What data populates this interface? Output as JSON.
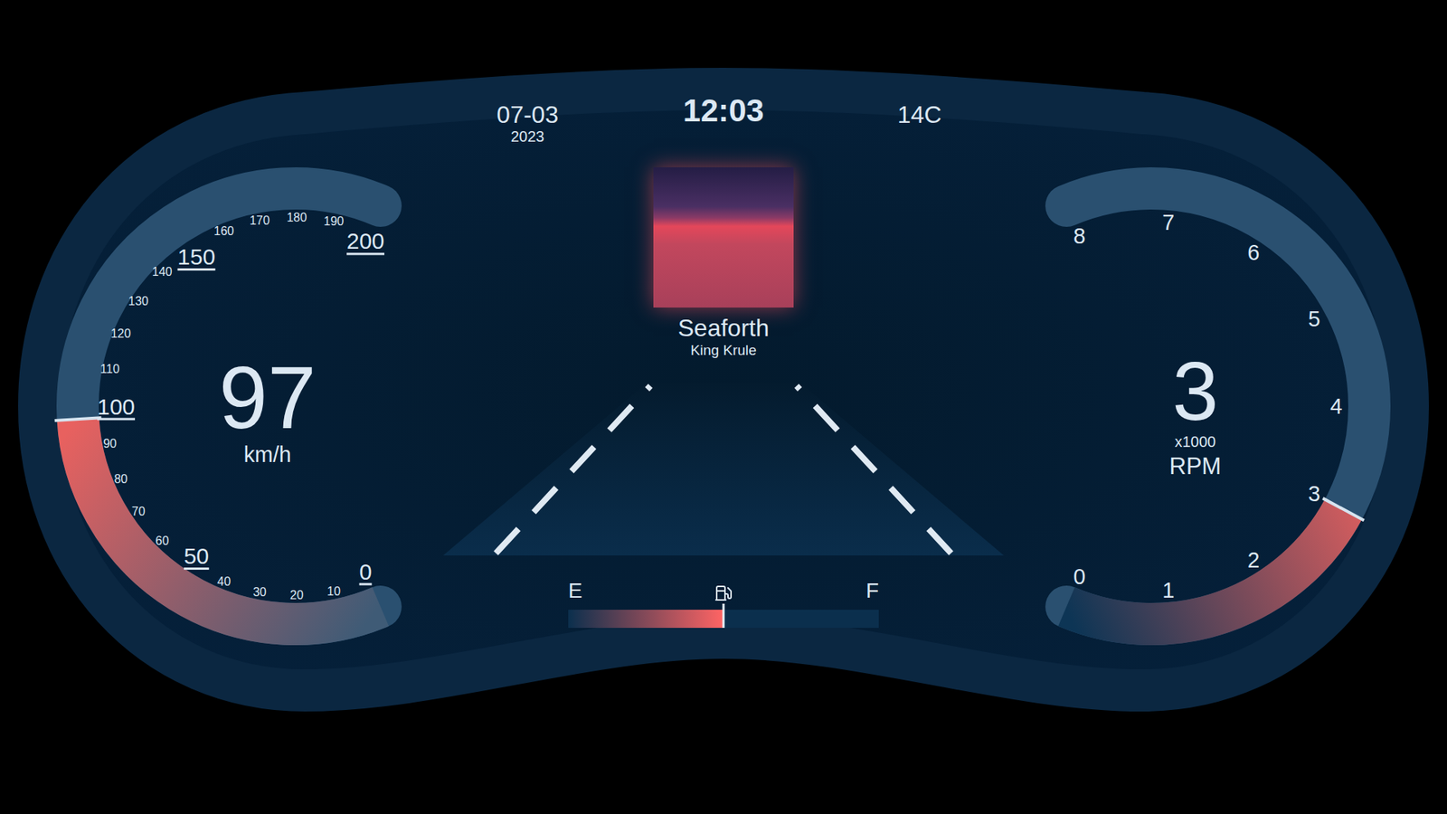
{
  "date": {
    "day": "07-03",
    "year": "2023"
  },
  "clock": "12:03",
  "temperature": "14C",
  "now_playing": {
    "title": "Seaforth",
    "artist": "King Krule"
  },
  "speedometer": {
    "value": "97",
    "unit": "km/h",
    "level": 0.485,
    "ticks": [
      {
        "label": "0",
        "major": true
      },
      {
        "label": "10",
        "major": false
      },
      {
        "label": "20",
        "major": false
      },
      {
        "label": "30",
        "major": false
      },
      {
        "label": "40",
        "major": false
      },
      {
        "label": "50",
        "major": true
      },
      {
        "label": "60",
        "major": false
      },
      {
        "label": "70",
        "major": false
      },
      {
        "label": "80",
        "major": false
      },
      {
        "label": "90",
        "major": false
      },
      {
        "label": "100",
        "major": true
      },
      {
        "label": "110",
        "major": false
      },
      {
        "label": "120",
        "major": false
      },
      {
        "label": "130",
        "major": false
      },
      {
        "label": "140",
        "major": false
      },
      {
        "label": "150",
        "major": true
      },
      {
        "label": "160",
        "major": false
      },
      {
        "label": "170",
        "major": false
      },
      {
        "label": "180",
        "major": false
      },
      {
        "label": "190",
        "major": false
      },
      {
        "label": "200",
        "major": true
      }
    ]
  },
  "tachometer": {
    "value": "3",
    "multiplier": "x1000",
    "unit": "RPM",
    "level": 0.375,
    "ticks": [
      {
        "label": "0",
        "major": false
      },
      {
        "label": "1",
        "major": false
      },
      {
        "label": "2",
        "major": false
      },
      {
        "label": "3",
        "major": false
      },
      {
        "label": "4",
        "major": false
      },
      {
        "label": "5",
        "major": false
      },
      {
        "label": "6",
        "major": false
      },
      {
        "label": "7",
        "major": false
      },
      {
        "label": "8",
        "major": false
      }
    ]
  },
  "fuel": {
    "empty_label": "E",
    "full_label": "F",
    "level": 0.5
  }
}
